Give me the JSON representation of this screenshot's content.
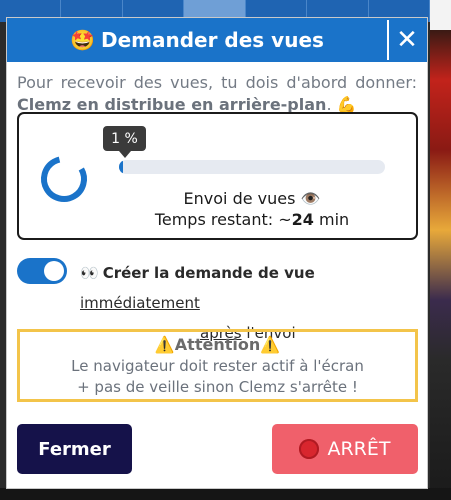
{
  "modal": {
    "title_emoji": "🤩",
    "title": "Demander des vues",
    "close_symbol": "✕"
  },
  "intro": {
    "text_prefix": "Pour recevoir des vues, tu dois d'abord donner: ",
    "text_bold": "Clemz en distribue en arrière-plan",
    "text_suffix": ". 💪"
  },
  "progress": {
    "percent_label": "1 %",
    "percent_value": 1,
    "sending_label": "Envoi de vues 👁️",
    "remaining_prefix": "Temps restant: ~",
    "remaining_value": "24",
    "remaining_unit": " min"
  },
  "toggle": {
    "state": "on",
    "eyes_emoji": "👀",
    "label_bold": "Créer la demande de vue",
    "label_link": "immédiatement",
    "label_link2": "après",
    "label_end": " l'envoi"
  },
  "warning": {
    "title": "⚠️Attention⚠️",
    "line1": "Le navigateur doit rester actif à l'écran",
    "line2": "+ pas de veille sinon Clemz s'arrête !"
  },
  "buttons": {
    "close_label": "Fermer",
    "stop_label": "ARRÊT"
  },
  "colors": {
    "header_blue": "#1a73c9",
    "warning_border": "#f3c44a",
    "close_button": "#15124a",
    "stop_button": "#f0606b"
  }
}
